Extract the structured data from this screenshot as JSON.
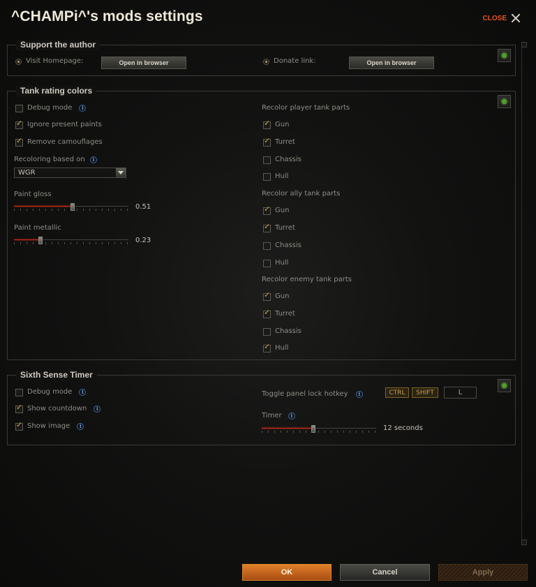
{
  "window": {
    "title": "^CHAMPi^'s mods settings",
    "close_label": "CLOSE"
  },
  "support": {
    "title": "Support the author",
    "homepage_label": "Visit Homepage:",
    "homepage_button": "Open in browser",
    "donate_label": "Donate link:",
    "donate_button": "Open in browser"
  },
  "tank": {
    "title": "Tank rating colors",
    "debug_mode": {
      "label": "Debug mode",
      "checked": false
    },
    "ignore_paints": {
      "label": "Ignore present paints",
      "checked": true
    },
    "remove_camo": {
      "label": "Remove camouflages",
      "checked": true
    },
    "recoloring_label": "Recoloring based on",
    "recoloring_value": "WGR",
    "gloss": {
      "label": "Paint gloss",
      "value": "0.51",
      "fraction": 0.51
    },
    "metallic": {
      "label": "Paint metallic",
      "value": "0.23",
      "fraction": 0.23
    },
    "player": {
      "title": "Recolor player tank parts",
      "gun": {
        "label": "Gun",
        "checked": true
      },
      "turret": {
        "label": "Turret",
        "checked": true
      },
      "chassis": {
        "label": "Chassis",
        "checked": false
      },
      "hull": {
        "label": "Hull",
        "checked": false
      }
    },
    "ally": {
      "title": "Recolor ally tank parts",
      "gun": {
        "label": "Gun",
        "checked": true
      },
      "turret": {
        "label": "Turret",
        "checked": true
      },
      "chassis": {
        "label": "Chassis",
        "checked": false
      },
      "hull": {
        "label": "Hull",
        "checked": false
      }
    },
    "enemy": {
      "title": "Recolor enemy tank parts",
      "gun": {
        "label": "Gun",
        "checked": true
      },
      "turret": {
        "label": "Turret",
        "checked": true
      },
      "chassis": {
        "label": "Chassis",
        "checked": false
      },
      "hull": {
        "label": "Hull",
        "checked": true
      }
    }
  },
  "sixth": {
    "title": "Sixth Sense Timer",
    "debug_mode": {
      "label": "Debug mode",
      "checked": false
    },
    "show_countdown": {
      "label": "Show countdown",
      "checked": true
    },
    "show_image": {
      "label": "Show image",
      "checked": true
    },
    "hotkey_label": "Toggle panel lock hotkey",
    "hotkey_ctrl": "CTRL",
    "hotkey_shift": "SHIFT",
    "hotkey_key": "L",
    "timer_label": "Timer",
    "timer_value": "12 seconds",
    "timer_fraction": 0.45
  },
  "footer": {
    "ok": "OK",
    "cancel": "Cancel",
    "apply": "Apply"
  },
  "icons": {
    "info": "info-icon",
    "collapse": "collapse-icon",
    "close": "close-icon"
  },
  "colors": {
    "accent": "#e07f2a",
    "slider_fill": "#c42a1a",
    "check": "#d1a530",
    "collapse_dot": "#4ea02a"
  }
}
